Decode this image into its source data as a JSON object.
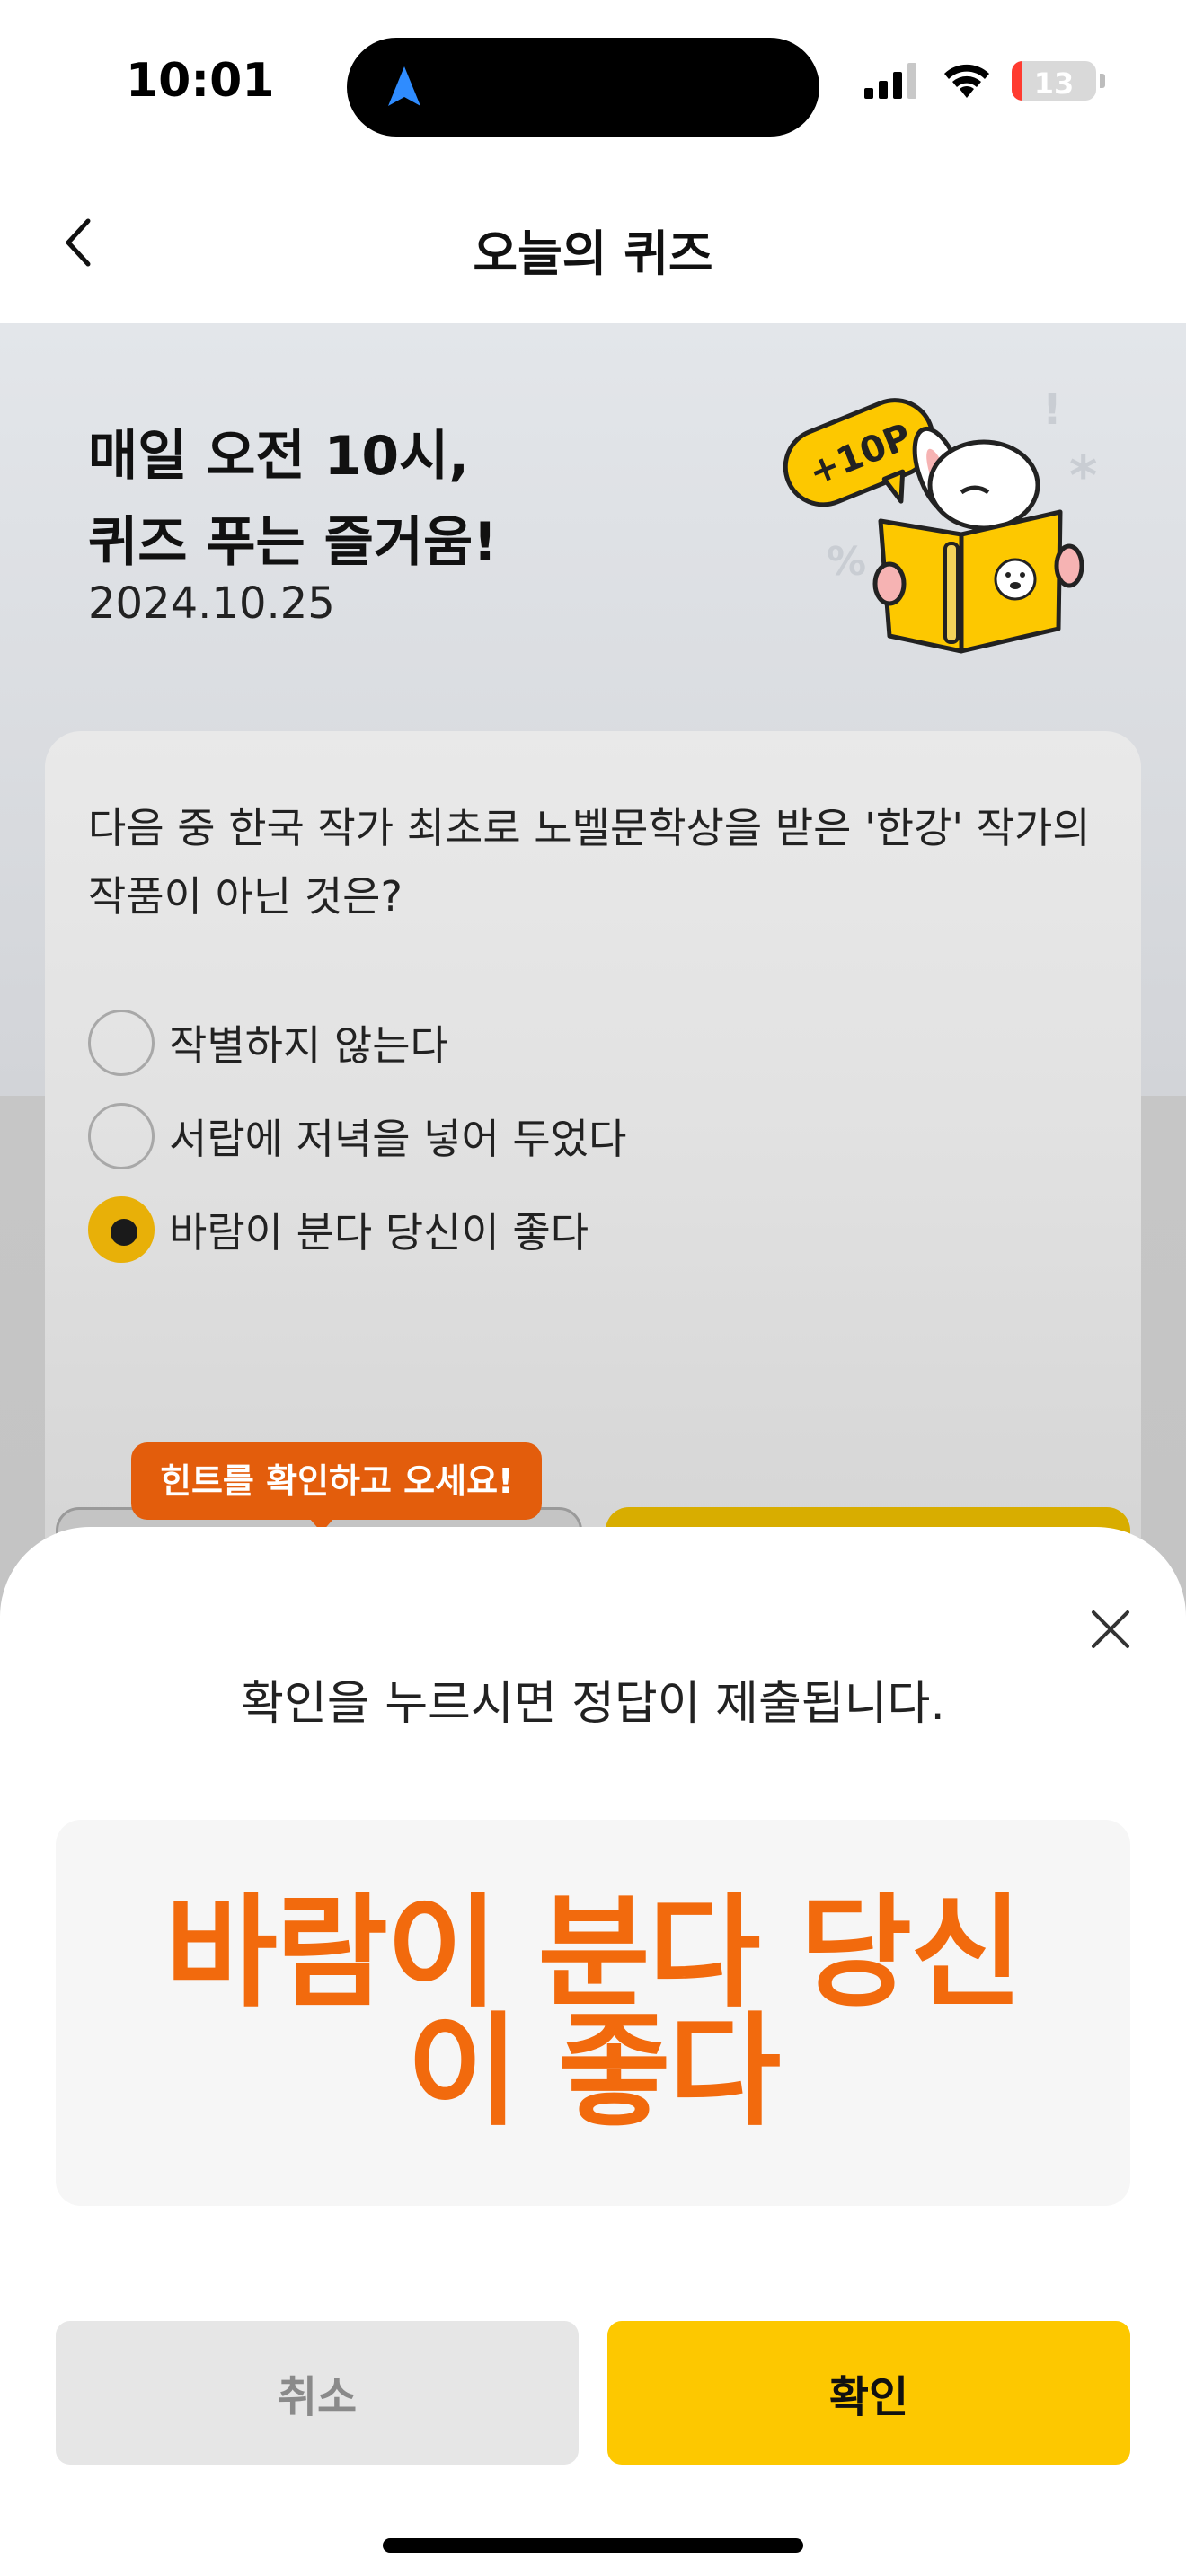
{
  "status_bar": {
    "time": "10:01",
    "battery_level": "13",
    "battery_fraction": 0.13,
    "icons": [
      "navigation-arrow-icon",
      "cellular-signal-icon",
      "wifi-icon",
      "battery-icon"
    ]
  },
  "header": {
    "title": "오늘의 퀴즈",
    "back_icon": "chevron-left-icon"
  },
  "promo": {
    "headline_line1": "매일 오전 10시,",
    "headline_line2": "퀴즈 푸는 즐거움!",
    "date": "2024.10.25",
    "badge": "+10P",
    "mascot": "rabbit-reading-book-illustration"
  },
  "quiz": {
    "question": "다음 중 한국 작가 최초로 노벨문학상을 받은 '한강' 작가의 작품이 아닌 것은?",
    "options": [
      {
        "label": "작별하지 않는다",
        "selected": false
      },
      {
        "label": "서랍에 저녁을 넣어 두었다",
        "selected": false
      },
      {
        "label": "바람이 분다 당신이 좋다",
        "selected": true
      }
    ],
    "hint_tooltip": "힌트를 확인하고 오세요!"
  },
  "confirm_sheet": {
    "message": "확인을 누르시면 정답이 제출됩니다.",
    "selected_answer": "바람이 분다 당신이 좋다",
    "cancel_label": "취소",
    "confirm_label": "확인",
    "close_icon": "close-icon"
  },
  "colors": {
    "accent_yellow": "#fdc800",
    "answer_orange": "#f26a0d",
    "tooltip_orange": "#e35d0c"
  }
}
